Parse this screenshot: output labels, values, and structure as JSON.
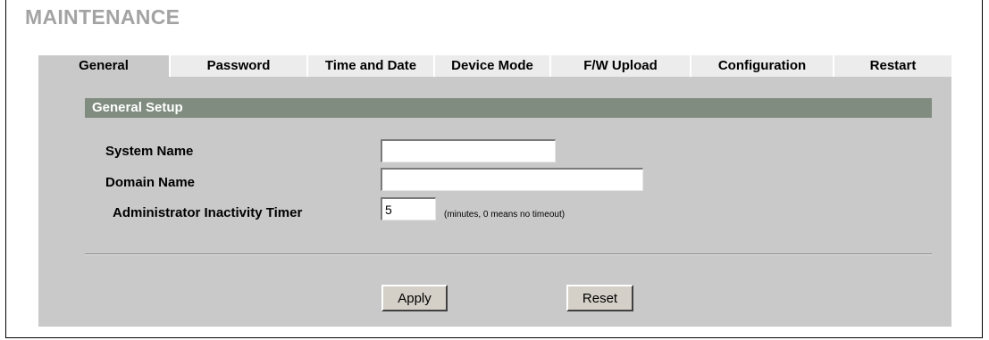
{
  "page": {
    "title": "MAINTENANCE"
  },
  "tabs": [
    {
      "label": "General",
      "active": true
    },
    {
      "label": "Password",
      "active": false
    },
    {
      "label": "Time and Date",
      "active": false
    },
    {
      "label": "Device Mode",
      "active": false
    },
    {
      "label": "F/W Upload",
      "active": false
    },
    {
      "label": "Configuration",
      "active": false
    },
    {
      "label": "Restart",
      "active": false
    }
  ],
  "section": {
    "title": "General Setup"
  },
  "form": {
    "system_name": {
      "label": "System Name",
      "value": ""
    },
    "domain_name": {
      "label": "Domain Name",
      "value": ""
    },
    "inactivity_timer": {
      "label": "Administrator Inactivity Timer",
      "value": "5",
      "hint": "(minutes, 0 means no timeout)"
    }
  },
  "buttons": {
    "apply": "Apply",
    "reset": "Reset"
  },
  "colors": {
    "title_gray": "#a3a3a3",
    "panel_gray": "#c9c9c9",
    "section_bar": "#7f8c7f",
    "tab_inactive": "#ececec"
  }
}
